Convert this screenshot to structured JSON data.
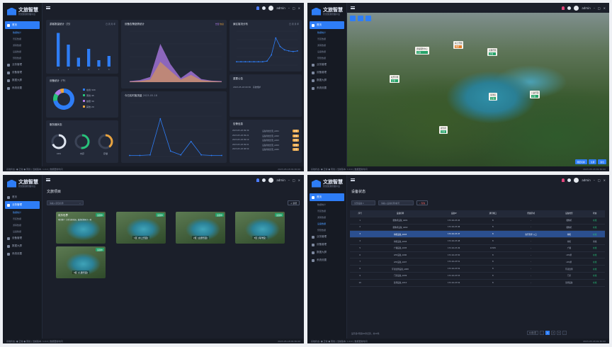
{
  "brand": {
    "title": "文旅智慧",
    "subtitle": "智慧旅游管理平台"
  },
  "nav": {
    "home": "首页",
    "subs": [
      "数据统计",
      "景区数据",
      "游客数据",
      "设备数据",
      "预警数据"
    ],
    "items": [
      "业务管理",
      "设备管理",
      "数据大屏",
      "系统设置"
    ]
  },
  "top": {
    "user": "admin"
  },
  "footer": {
    "left": "系统状态: ● 正常 ● 离线 | 当前版本: 1.0.0 | 数据更新时间",
    "right": "2023-05-18 09:30:00"
  },
  "dashboard": {
    "card_visitors": {
      "title": "游客数量统计（万）",
      "sub": "日 周 月 年",
      "chart_data": {
        "type": "bar",
        "categories": [
          "1",
          "2",
          "3",
          "4",
          "5",
          "6"
        ],
        "values": [
          95,
          62,
          25,
          50,
          18,
          30
        ],
        "ylim": [
          0,
          100
        ]
      }
    },
    "card_trend": {
      "title": "设备告警趋势统计",
      "legend": [
        "告警",
        "恢复"
      ],
      "chart_data": {
        "type": "area",
        "x": [
          0,
          1,
          2,
          3,
          4,
          5,
          6,
          7,
          8,
          9
        ],
        "series": [
          {
            "name": "告警",
            "values": [
              2,
              4,
              10,
              75,
              35,
              8,
              22,
              6,
              3,
              2
            ]
          },
          {
            "name": "恢复",
            "values": [
              1,
              2,
              5,
              40,
              22,
              5,
              14,
              4,
              2,
              1
            ]
          }
        ],
        "ylim": [
          0,
          100
        ]
      }
    },
    "card_dist": {
      "title": "景区客流分布",
      "sub": "日 周 月 年",
      "chart_data": {
        "type": "line",
        "x": [
          1,
          2,
          3,
          4,
          5,
          6,
          7,
          8,
          9,
          10,
          11,
          12,
          13,
          14,
          15
        ],
        "values": [
          10,
          10,
          10,
          10,
          10,
          10,
          10,
          12,
          30,
          80,
          55,
          45,
          42,
          40,
          42
        ],
        "ylim": [
          0,
          100
        ]
      }
    },
    "card_pie": {
      "title": "设备统计（个）",
      "chart_data": {
        "type": "pie",
        "values": [
          72,
          12,
          10,
          6
        ]
      },
      "legend": [
        "在线 320",
        "离线 45",
        "故障 30",
        "其他 20"
      ]
    },
    "card_notice": {
      "title": "重要公告",
      "date": "2023-05-18 09:30",
      "text": "系统维护"
    },
    "card_flow": {
      "title": "今日实时客流量",
      "date": "2023-05-18",
      "chart_data": {
        "type": "line",
        "x": [
          0,
          1,
          2,
          3,
          4,
          5,
          6,
          7,
          8,
          9
        ],
        "values": [
          2,
          2,
          3,
          70,
          10,
          3,
          28,
          3,
          2,
          2
        ],
        "ylim": [
          0,
          100
        ]
      }
    },
    "card_server": {
      "title": "服务器状态",
      "gauges": [
        {
          "label": "CPU",
          "value": 68
        },
        {
          "label": "内存",
          "value": 52
        },
        {
          "label": "存储",
          "value": 40
        }
      ]
    },
    "card_alerts": {
      "title": "告警信息",
      "rows": [
        {
          "time": "2023-05-18 09:30",
          "text": "设备离线告警_A001",
          "level": "告警"
        },
        {
          "time": "2023-05-18 09:21",
          "text": "设备离线告警_A002",
          "level": "告警"
        },
        {
          "time": "2023-05-18 09:10",
          "text": "设备离线告警_A003",
          "level": "告警"
        },
        {
          "time": "2023-05-18 09:01",
          "text": "设备离线告警_A004",
          "level": "告警"
        },
        {
          "time": "2023-05-18 08:50",
          "text": "设备离线告警_A005",
          "level": "告警"
        }
      ]
    }
  },
  "map": {
    "pins": [
      {
        "label": "游客服务中心",
        "status": "正常"
      },
      {
        "label": "水上乐园",
        "status": "拥挤",
        "hot": true
      },
      {
        "label": "主题乐园",
        "status": "正常"
      },
      {
        "label": "欢乐世界",
        "status": "正常"
      },
      {
        "label": "海洋馆",
        "status": "正常"
      },
      {
        "label": "儿童乐园",
        "status": "正常"
      },
      {
        "label": "观光塔",
        "status": "正常"
      }
    ],
    "controls": [
      "图层切换",
      "全屏",
      "复位"
    ]
  },
  "projects": {
    "title": "文旅项目",
    "search_placeholder": "请输入项目名称",
    "add": "新增",
    "cards": [
      {
        "name": "欢乐世界",
        "tag": "运营中",
        "desc": "项目简介: 大型主题乐园，集游乐休闲于一体"
      },
      {
        "name": "1区 (水上乐园)",
        "tag": "运营中"
      },
      {
        "name": "2区 (主题乐园)",
        "tag": "运营中"
      },
      {
        "name": "3区 (海洋馆)",
        "tag": "运营中"
      },
      {
        "name": "4区 (儿童乐园)",
        "tag": "运营中"
      }
    ]
  },
  "devices": {
    "title": "设备状态",
    "filter1": "全部设备",
    "filter2": "请输入设备名称/编号",
    "query": "查询",
    "headers": [
      "序号",
      "设备名称",
      "设备IP",
      "通讯端口",
      "所属区域",
      "设备类型",
      "状态"
    ],
    "rows": [
      [
        "1",
        "摄像机设备_A001",
        "172.16.23.45",
        "8",
        "-",
        "摄像机",
        "在线"
      ],
      [
        "2",
        "摄像机设备_A002",
        "172.16.23.46",
        "8",
        "-",
        "摄像机",
        "在线"
      ],
      [
        "3",
        "闸机设备_A003",
        "172.16.23.47",
        "8",
        "欢乐世界 入口",
        "闸机",
        "在线"
      ],
      [
        "4",
        "闸机设备_A004",
        "172.16.23.48",
        "8",
        "-",
        "闸机",
        "离线"
      ],
      [
        "5",
        "广播设备_A005",
        "172.16.23.49",
        "12345",
        "-",
        "广播",
        "在线"
      ],
      [
        "6",
        "LED设备_A006",
        "172.16.23.50",
        "8",
        "-",
        "LED屏",
        "在线"
      ],
      [
        "7",
        "LED设备_A007",
        "172.16.23.51",
        "8",
        "-",
        "LED屏",
        "在线"
      ],
      [
        "8",
        "环境监测设备_A008",
        "172.16.23.52",
        "8",
        "-",
        "环境监测",
        "在线"
      ],
      [
        "9",
        "门禁设备_A009",
        "172.16.23.53",
        "8",
        "-",
        "门禁",
        "在线"
      ],
      [
        "10",
        "监测设备_A010",
        "172.16.23.54",
        "8",
        "-",
        "监测设备",
        "在线"
      ]
    ],
    "total": "显示第1到第10条记录，共10条",
    "page_size": "10条/页",
    "pages": [
      "1",
      "2",
      "3"
    ]
  }
}
